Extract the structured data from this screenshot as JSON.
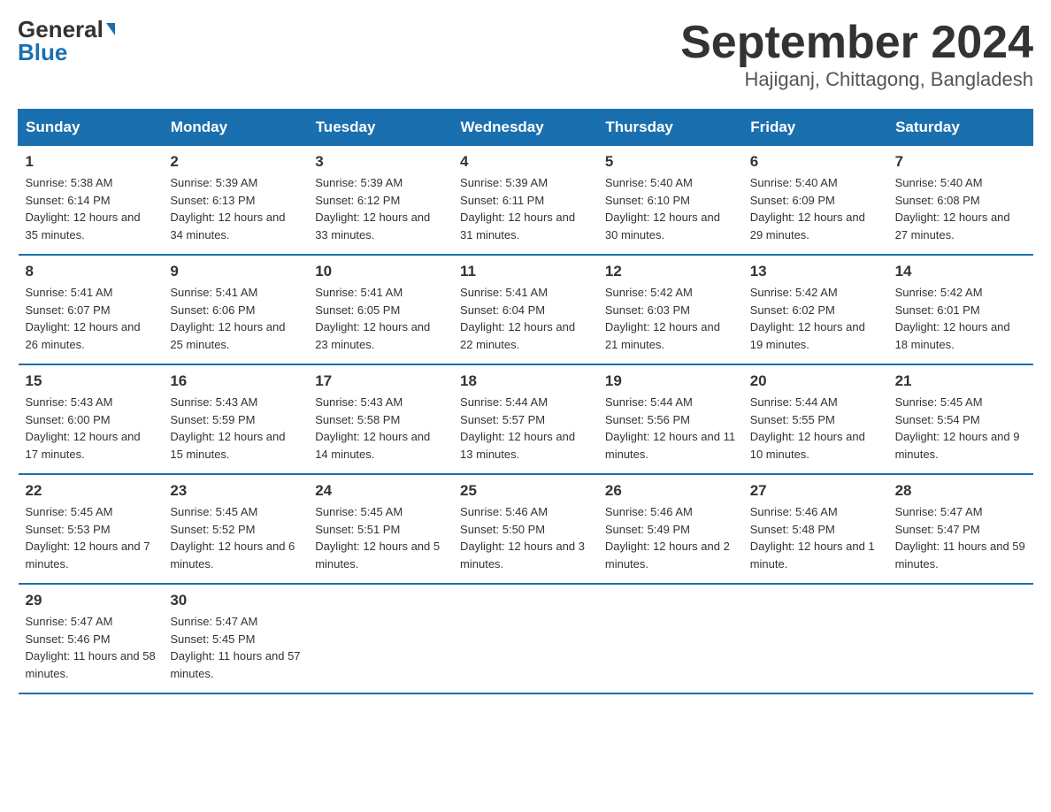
{
  "header": {
    "logo_general": "General",
    "logo_blue": "Blue",
    "calendar_title": "September 2024",
    "calendar_subtitle": "Hajiganj, Chittagong, Bangladesh"
  },
  "weekdays": [
    "Sunday",
    "Monday",
    "Tuesday",
    "Wednesday",
    "Thursday",
    "Friday",
    "Saturday"
  ],
  "weeks": [
    [
      {
        "day": "1",
        "sunrise": "5:38 AM",
        "sunset": "6:14 PM",
        "daylight": "12 hours and 35 minutes."
      },
      {
        "day": "2",
        "sunrise": "5:39 AM",
        "sunset": "6:13 PM",
        "daylight": "12 hours and 34 minutes."
      },
      {
        "day": "3",
        "sunrise": "5:39 AM",
        "sunset": "6:12 PM",
        "daylight": "12 hours and 33 minutes."
      },
      {
        "day": "4",
        "sunrise": "5:39 AM",
        "sunset": "6:11 PM",
        "daylight": "12 hours and 31 minutes."
      },
      {
        "day": "5",
        "sunrise": "5:40 AM",
        "sunset": "6:10 PM",
        "daylight": "12 hours and 30 minutes."
      },
      {
        "day": "6",
        "sunrise": "5:40 AM",
        "sunset": "6:09 PM",
        "daylight": "12 hours and 29 minutes."
      },
      {
        "day": "7",
        "sunrise": "5:40 AM",
        "sunset": "6:08 PM",
        "daylight": "12 hours and 27 minutes."
      }
    ],
    [
      {
        "day": "8",
        "sunrise": "5:41 AM",
        "sunset": "6:07 PM",
        "daylight": "12 hours and 26 minutes."
      },
      {
        "day": "9",
        "sunrise": "5:41 AM",
        "sunset": "6:06 PM",
        "daylight": "12 hours and 25 minutes."
      },
      {
        "day": "10",
        "sunrise": "5:41 AM",
        "sunset": "6:05 PM",
        "daylight": "12 hours and 23 minutes."
      },
      {
        "day": "11",
        "sunrise": "5:41 AM",
        "sunset": "6:04 PM",
        "daylight": "12 hours and 22 minutes."
      },
      {
        "day": "12",
        "sunrise": "5:42 AM",
        "sunset": "6:03 PM",
        "daylight": "12 hours and 21 minutes."
      },
      {
        "day": "13",
        "sunrise": "5:42 AM",
        "sunset": "6:02 PM",
        "daylight": "12 hours and 19 minutes."
      },
      {
        "day": "14",
        "sunrise": "5:42 AM",
        "sunset": "6:01 PM",
        "daylight": "12 hours and 18 minutes."
      }
    ],
    [
      {
        "day": "15",
        "sunrise": "5:43 AM",
        "sunset": "6:00 PM",
        "daylight": "12 hours and 17 minutes."
      },
      {
        "day": "16",
        "sunrise": "5:43 AM",
        "sunset": "5:59 PM",
        "daylight": "12 hours and 15 minutes."
      },
      {
        "day": "17",
        "sunrise": "5:43 AM",
        "sunset": "5:58 PM",
        "daylight": "12 hours and 14 minutes."
      },
      {
        "day": "18",
        "sunrise": "5:44 AM",
        "sunset": "5:57 PM",
        "daylight": "12 hours and 13 minutes."
      },
      {
        "day": "19",
        "sunrise": "5:44 AM",
        "sunset": "5:56 PM",
        "daylight": "12 hours and 11 minutes."
      },
      {
        "day": "20",
        "sunrise": "5:44 AM",
        "sunset": "5:55 PM",
        "daylight": "12 hours and 10 minutes."
      },
      {
        "day": "21",
        "sunrise": "5:45 AM",
        "sunset": "5:54 PM",
        "daylight": "12 hours and 9 minutes."
      }
    ],
    [
      {
        "day": "22",
        "sunrise": "5:45 AM",
        "sunset": "5:53 PM",
        "daylight": "12 hours and 7 minutes."
      },
      {
        "day": "23",
        "sunrise": "5:45 AM",
        "sunset": "5:52 PM",
        "daylight": "12 hours and 6 minutes."
      },
      {
        "day": "24",
        "sunrise": "5:45 AM",
        "sunset": "5:51 PM",
        "daylight": "12 hours and 5 minutes."
      },
      {
        "day": "25",
        "sunrise": "5:46 AM",
        "sunset": "5:50 PM",
        "daylight": "12 hours and 3 minutes."
      },
      {
        "day": "26",
        "sunrise": "5:46 AM",
        "sunset": "5:49 PM",
        "daylight": "12 hours and 2 minutes."
      },
      {
        "day": "27",
        "sunrise": "5:46 AM",
        "sunset": "5:48 PM",
        "daylight": "12 hours and 1 minute."
      },
      {
        "day": "28",
        "sunrise": "5:47 AM",
        "sunset": "5:47 PM",
        "daylight": "11 hours and 59 minutes."
      }
    ],
    [
      {
        "day": "29",
        "sunrise": "5:47 AM",
        "sunset": "5:46 PM",
        "daylight": "11 hours and 58 minutes."
      },
      {
        "day": "30",
        "sunrise": "5:47 AM",
        "sunset": "5:45 PM",
        "daylight": "11 hours and 57 minutes."
      },
      null,
      null,
      null,
      null,
      null
    ]
  ]
}
